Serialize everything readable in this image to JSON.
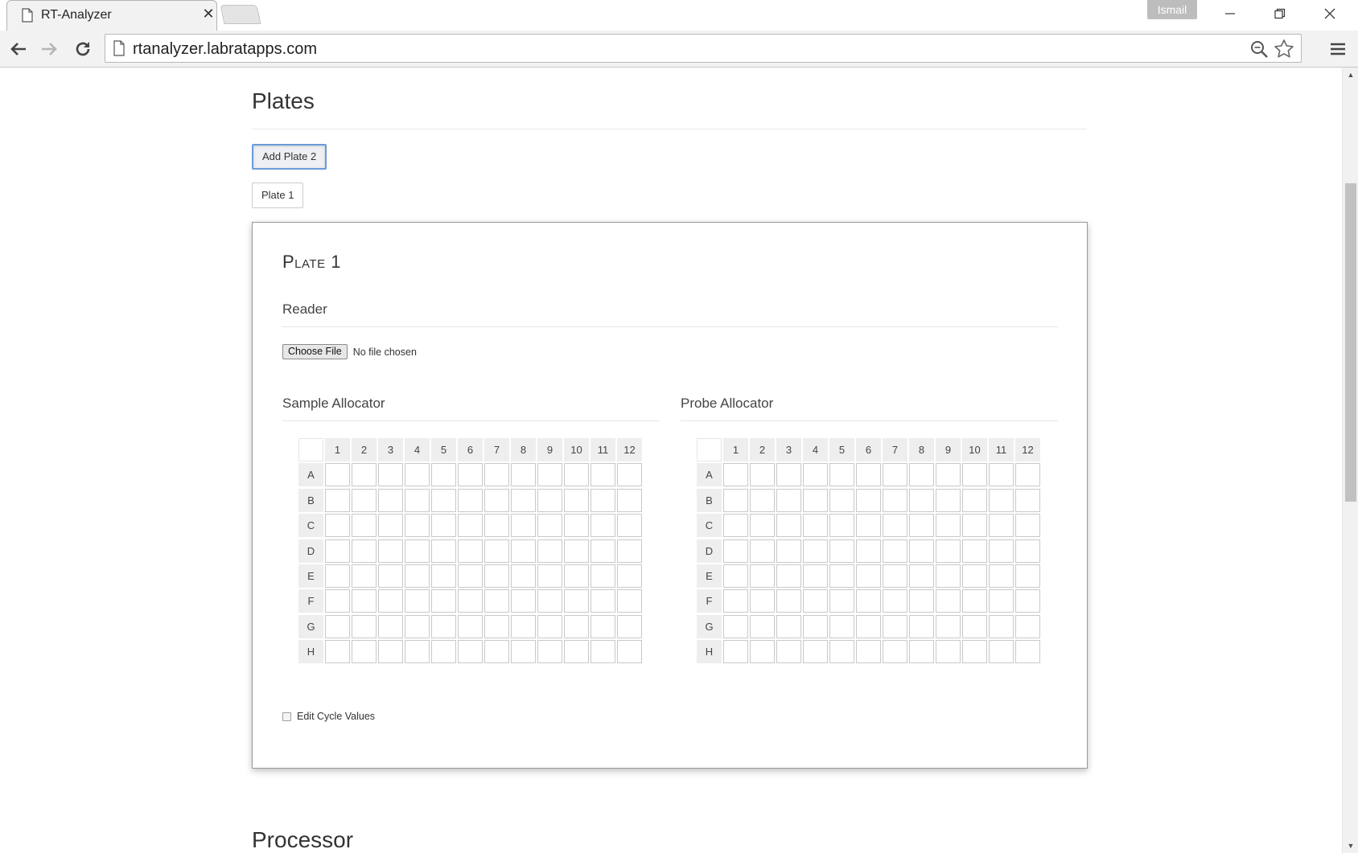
{
  "browser": {
    "tab_title": "RT-Analyzer",
    "tab_close": "✕",
    "profile_name": "Ismail",
    "url": "rtanalyzer.labratapps.com"
  },
  "page": {
    "plates_title": "Plates",
    "add_plate_label": "Add Plate 2",
    "plate_tab_label": "Plate 1",
    "processor_title": "Processor",
    "plate": {
      "heading": "Plate 1",
      "reader_heading": "Reader",
      "choose_file_label": "Choose File",
      "file_status": "No file chosen",
      "sample_allocator_heading": "Sample Allocator",
      "probe_allocator_heading": "Probe Allocator",
      "columns": [
        "1",
        "2",
        "3",
        "4",
        "5",
        "6",
        "7",
        "8",
        "9",
        "10",
        "11",
        "12"
      ],
      "rows": [
        "A",
        "B",
        "C",
        "D",
        "E",
        "F",
        "G",
        "H"
      ],
      "edit_cycle_label": "Edit Cycle Values",
      "edit_cycle_checked": false
    }
  }
}
